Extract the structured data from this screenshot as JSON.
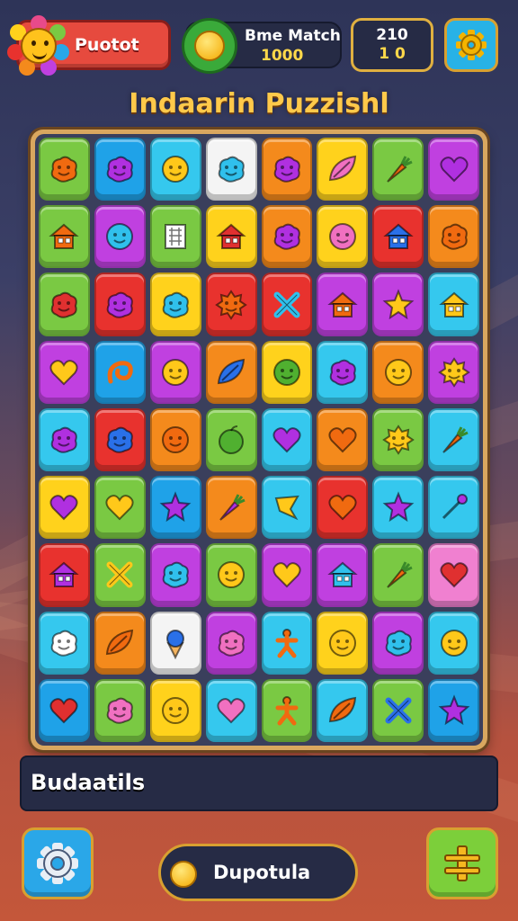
{
  "hud": {
    "profile_label": "Puotot",
    "match_title": "Bme Match",
    "match_value": "1000",
    "score_top": "210",
    "score_bottom": "1 0"
  },
  "title": "Indaarin Puzzishl",
  "board": {
    "rows": 9,
    "cols": 8,
    "tiles": [
      [
        "green",
        "blob",
        "orange"
      ],
      [
        "blue",
        "blob",
        "purple"
      ],
      [
        "cyan",
        "face",
        "yellow"
      ],
      [
        "white",
        "blob",
        "cyan"
      ],
      [
        "orange",
        "blob",
        "purple"
      ],
      [
        "yellow",
        "leaf",
        "pink"
      ],
      [
        "green",
        "carrot",
        "orange"
      ],
      [
        "purple",
        "heart",
        "purple"
      ],
      [
        "green",
        "house",
        "orange"
      ],
      [
        "purple",
        "face",
        "cyan"
      ],
      [
        "green",
        "grid",
        "white"
      ],
      [
        "yellow",
        "house",
        "red"
      ],
      [
        "orange",
        "blob",
        "purple"
      ],
      [
        "yellow",
        "face",
        "pink"
      ],
      [
        "red",
        "house",
        "blue"
      ],
      [
        "orange",
        "blob",
        "orange"
      ],
      [
        "green",
        "blob",
        "red"
      ],
      [
        "red",
        "blob",
        "purple"
      ],
      [
        "yellow",
        "blob",
        "cyan"
      ],
      [
        "red",
        "sun",
        "orange"
      ],
      [
        "red",
        "cross",
        "cyan"
      ],
      [
        "purple",
        "house",
        "orange"
      ],
      [
        "purple",
        "star",
        "yellow"
      ],
      [
        "cyan",
        "house",
        "yellow"
      ],
      [
        "purple",
        "heart",
        "yellow"
      ],
      [
        "blue",
        "swirl",
        "orange"
      ],
      [
        "purple",
        "face",
        "yellow"
      ],
      [
        "orange",
        "leaf",
        "blue"
      ],
      [
        "yellow",
        "face",
        "green"
      ],
      [
        "cyan",
        "blob",
        "purple"
      ],
      [
        "orange",
        "face",
        "yellow"
      ],
      [
        "purple",
        "sun",
        "yellow"
      ],
      [
        "cyan",
        "blob",
        "purple"
      ],
      [
        "red",
        "blob",
        "blue"
      ],
      [
        "orange",
        "face",
        "orange"
      ],
      [
        "green",
        "apple",
        "green"
      ],
      [
        "cyan",
        "heart",
        "purple"
      ],
      [
        "orange",
        "heart",
        "orange"
      ],
      [
        "green",
        "sun",
        "yellow"
      ],
      [
        "cyan",
        "carrot",
        "orange"
      ],
      [
        "yellow",
        "heart",
        "purple"
      ],
      [
        "green",
        "heart",
        "yellow"
      ],
      [
        "blue",
        "star",
        "purple"
      ],
      [
        "orange",
        "carrot",
        "purple"
      ],
      [
        "cyan",
        "kite",
        "yellow"
      ],
      [
        "red",
        "heart",
        "orange"
      ],
      [
        "cyan",
        "star",
        "purple"
      ],
      [
        "cyan",
        "wand",
        "purple"
      ],
      [
        "red",
        "house",
        "purple"
      ],
      [
        "green",
        "cross",
        "yellow"
      ],
      [
        "purple",
        "blob",
        "cyan"
      ],
      [
        "green",
        "face",
        "yellow"
      ],
      [
        "purple",
        "heart",
        "yellow"
      ],
      [
        "purple",
        "house",
        "cyan"
      ],
      [
        "green",
        "carrot",
        "orange"
      ],
      [
        "pink",
        "heart",
        "red"
      ],
      [
        "cyan",
        "blob",
        "white"
      ],
      [
        "orange",
        "leaf",
        "orange"
      ],
      [
        "white",
        "icecream",
        "blue"
      ],
      [
        "purple",
        "blob",
        "pink"
      ],
      [
        "cyan",
        "figure",
        "orange"
      ],
      [
        "yellow",
        "face",
        "yellow"
      ],
      [
        "purple",
        "blob",
        "cyan"
      ],
      [
        "cyan",
        "face",
        "yellow"
      ],
      [
        "blue",
        "heart",
        "red"
      ],
      [
        "green",
        "blob",
        "pink"
      ],
      [
        "yellow",
        "face",
        "yellow"
      ],
      [
        "cyan",
        "heart",
        "pink"
      ],
      [
        "green",
        "figure",
        "orange"
      ],
      [
        "cyan",
        "leaf",
        "orange"
      ],
      [
        "green",
        "cross",
        "blue"
      ],
      [
        "blue",
        "star",
        "purple"
      ]
    ]
  },
  "message": "Budaatils",
  "bottom": {
    "center_label": "Dupotula"
  },
  "palette": {
    "green": "#7ac943",
    "blue": "#1fa2e8",
    "cyan": "#35c8ee",
    "white": "#f4f4f4",
    "orange": "#f48a1c",
    "yellow": "#ffd21c",
    "purple": "#c040e0",
    "red": "#e8322e",
    "pink": "#f080d0"
  },
  "icon_colors": {
    "orange": "#f06a10",
    "purple": "#b030e0",
    "yellow": "#ffc81a",
    "cyan": "#30c0ec",
    "pink": "#f070c0",
    "red": "#e03030",
    "white": "#ffffff",
    "blue": "#2a70e8",
    "green": "#50b030"
  }
}
